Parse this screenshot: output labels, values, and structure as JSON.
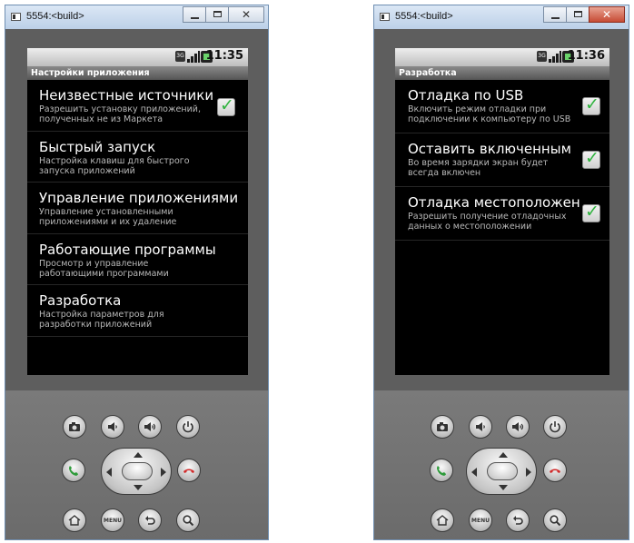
{
  "windows": [
    {
      "title": "5554:<build>",
      "statusbar_time": "11:35",
      "appbar_title": "Настройки приложения",
      "items": [
        {
          "title": "Неизвестные источники",
          "subtitle": "Разрешить установку приложений, полученных не из Маркета",
          "checked": true
        },
        {
          "title": "Быстрый запуск",
          "subtitle": "Настройка клавиш для быстрого запуска приложений",
          "checked": null
        },
        {
          "title": "Управление приложениями",
          "subtitle": "Управление установленными приложениями и их удаление",
          "checked": null
        },
        {
          "title": "Работающие программы",
          "subtitle": "Просмотр и управление работающими программами",
          "checked": null
        },
        {
          "title": "Разработка",
          "subtitle": "Настройка параметров для разработки приложений",
          "checked": null
        }
      ]
    },
    {
      "title": "5554:<build>",
      "statusbar_time": "11:36",
      "appbar_title": "Разработка",
      "items": [
        {
          "title": "Отладка по USB",
          "subtitle": "Включить режим отладки при подключении к компьютеру по USB",
          "checked": true
        },
        {
          "title": "Оставить включенным",
          "subtitle": "Во время зарядки экран будет всегда включен",
          "checked": true
        },
        {
          "title": "Отладка местоположен",
          "subtitle": "Разрешить получение отладочных данных о местоположении",
          "checked": true
        }
      ]
    }
  ],
  "emulator_buttons": {
    "menu_label": "MENU",
    "icons": [
      "camera-icon",
      "volume-down-icon",
      "volume-up-icon",
      "power-icon",
      "call-icon",
      "end-call-icon",
      "home-icon",
      "menu-icon",
      "back-icon",
      "search-icon"
    ]
  },
  "colors": {
    "window_frame": "#b9cde5",
    "emulator_body": "#666666",
    "screen_bg": "#000000",
    "check_green": "#2fb33e",
    "call_green": "#2e9b3a",
    "end_call_red": "#d12a2a"
  }
}
